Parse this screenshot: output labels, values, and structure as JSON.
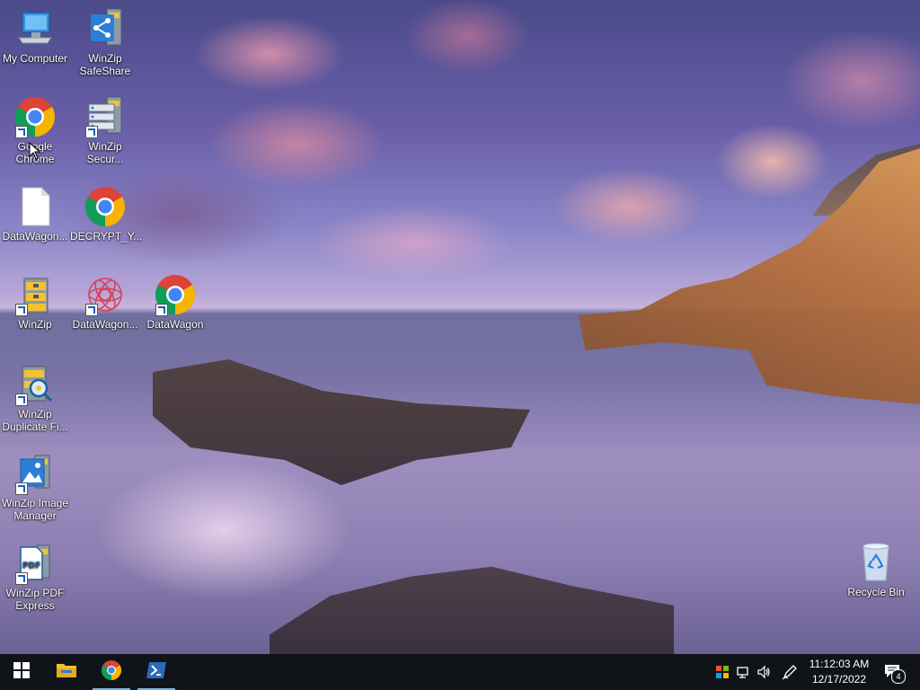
{
  "desktop": {
    "icons": [
      {
        "id": "my-computer",
        "label": "My Computer"
      },
      {
        "id": "winzip-safeshare",
        "label": "WinZip SafeShare"
      },
      {
        "id": "google-chrome",
        "label": "Google Chrome"
      },
      {
        "id": "winzip-secure",
        "label": "WinZip Secur..."
      },
      {
        "id": "datawagon-file",
        "label": "DataWagon..."
      },
      {
        "id": "decrypt",
        "label": "DECRYPT_Y..."
      },
      {
        "id": "winzip",
        "label": "WinZip"
      },
      {
        "id": "datawagon-app",
        "label": "DataWagon..."
      },
      {
        "id": "datawagon-chrome",
        "label": "DataWagon"
      },
      {
        "id": "winzip-duplicate",
        "label": "WinZip Duplicate Fi..."
      },
      {
        "id": "winzip-image",
        "label": "WinZip Image Manager"
      },
      {
        "id": "winzip-pdf",
        "label": "WinZip PDF Express"
      },
      {
        "id": "recycle-bin",
        "label": "Recycle Bin"
      }
    ]
  },
  "taskbar": {
    "start_icon": "windows-logo",
    "pinned": [
      {
        "id": "file-explorer",
        "icon": "folder-icon"
      },
      {
        "id": "chrome",
        "icon": "chrome-icon"
      },
      {
        "id": "powershell",
        "icon": "powershell-icon"
      }
    ],
    "tray": {
      "time": "11:12:03 AM",
      "date": "12/17/2022",
      "notification_count": "4"
    }
  },
  "colors": {
    "taskbar_bg": "#101418",
    "accent": "#7ab0e8",
    "chrome_red": "#db4437",
    "chrome_green": "#0f9d58",
    "chrome_yellow": "#f4b400",
    "chrome_blue": "#4285f4"
  }
}
